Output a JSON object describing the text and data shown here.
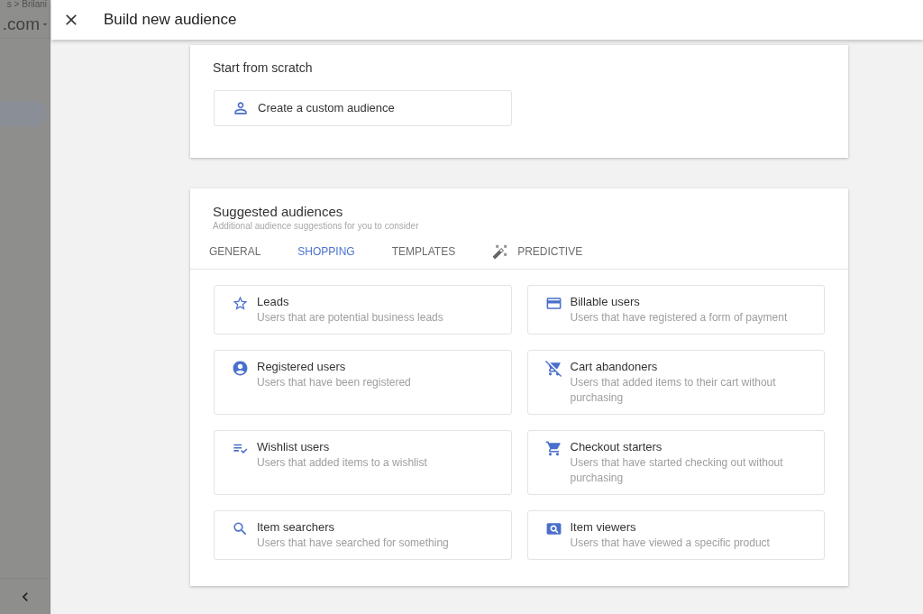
{
  "background_page": {
    "breadcrumb": "s > Brilani",
    "property": ".com"
  },
  "dialog": {
    "title": "Build new audience"
  },
  "start_from_scratch": {
    "title": "Start from scratch",
    "button": "Create a custom audience"
  },
  "suggested_audiences": {
    "title": "Suggested audiences",
    "subtitle": "Additional audience suggestions for you to consider",
    "tabs": [
      {
        "label": "GENERAL",
        "kind": "plain",
        "selected": false
      },
      {
        "label": "SHOPPING",
        "kind": "plain",
        "selected": true
      },
      {
        "label": "TEMPLATES",
        "kind": "plain",
        "selected": false
      },
      {
        "label": "PREDICTIVE",
        "kind": "icon",
        "selected": false
      }
    ],
    "audiences": [
      {
        "title": "Leads",
        "description": "Users that are potential business leads"
      },
      {
        "title": "Billable users",
        "description": "Users that have registered a form of payment"
      },
      {
        "title": "Registered users",
        "description": "Users that have been registered"
      },
      {
        "title": "Cart abandoners",
        "description": "Users that added items to their cart without purchasing"
      },
      {
        "title": "Wishlist users",
        "description": "Users that added items to a wishlist"
      },
      {
        "title": "Checkout starters",
        "description": "Users that have started checking out without purchasing"
      },
      {
        "title": "Item searchers",
        "description": "Users that have searched for something"
      },
      {
        "title": "Item viewers",
        "description": "Users that have viewed a specific product"
      }
    ]
  }
}
